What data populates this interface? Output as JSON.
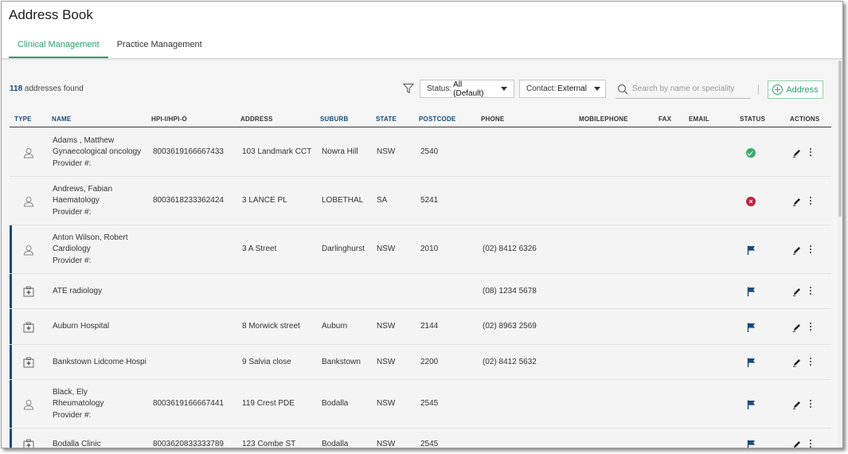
{
  "app": {
    "title": "Address Book"
  },
  "tabs": [
    {
      "label": "Clinical Management",
      "active": true
    },
    {
      "label": "Practice Management",
      "active": false
    }
  ],
  "toolbar": {
    "count": "118",
    "count_suffix": " addresses found",
    "status_label": "Status:",
    "status_value": "All (Default)",
    "contact_label": "Contact:",
    "contact_value": "External",
    "search_placeholder": "Search by name or speciality",
    "add_label": "Address"
  },
  "columns": {
    "type": "TYPE",
    "name": "NAME",
    "hpi": "HPI-I/HPI-O",
    "address": "ADDRESS",
    "suburb": "SUBURB",
    "state": "STATE",
    "postcode": "POSTCODE",
    "phone": "PHONE",
    "mobile": "MOBILEPHONE",
    "fax": "FAX",
    "email": "EMAIL",
    "status": "STATUS",
    "actions": "ACTIONS"
  },
  "colors": {
    "accent": "#2e9e6b",
    "navy": "#1a4a78",
    "ok": "#3aaa6b",
    "error": "#c0213f"
  },
  "rows": [
    {
      "type_icon": "person-icon",
      "name": [
        "Adams , Matthew",
        "Gynaecological oncology",
        "Provider #:"
      ],
      "hpi": "8003619166667433",
      "address": "103 Landmark CCT",
      "suburb": "Nowra Hill",
      "state": "NSW",
      "postcode": "2540",
      "phone": "",
      "status": "active",
      "marker": false
    },
    {
      "type_icon": "person-icon",
      "name": [
        "Andrews, Fabian",
        "Haematology",
        "Provider #:"
      ],
      "hpi": "8003618233362424",
      "address": "3 LANCE PL",
      "suburb": "LOBETHAL",
      "state": "SA",
      "postcode": "5241",
      "phone": "",
      "status": "inactive",
      "marker": false
    },
    {
      "type_icon": "person-icon",
      "name": [
        "Anton Wilson, Robert",
        "Cardiology",
        "Provider #:"
      ],
      "hpi": "",
      "address": "3 A Street",
      "suburb": "Darlinghurst",
      "state": "NSW",
      "postcode": "2010",
      "phone": "(02) 8412 6326",
      "status": "flagged",
      "marker": true
    },
    {
      "type_icon": "hospital-icon",
      "name": [
        "ATE radiology"
      ],
      "hpi": "",
      "address": "",
      "suburb": "",
      "state": "",
      "postcode": "",
      "phone": "(08) 1234 5678",
      "status": "flagged",
      "marker": true
    },
    {
      "type_icon": "hospital-icon",
      "name": [
        "Auburn Hospital"
      ],
      "hpi": "",
      "address": "8 Morwick street",
      "suburb": "Auburn",
      "state": "NSW",
      "postcode": "2144",
      "phone": "(02) 8963 2569",
      "status": "flagged",
      "marker": true
    },
    {
      "type_icon": "hospital-icon",
      "name": [
        "Bankstown Lidcome Hospi"
      ],
      "hpi": "",
      "address": "9 Salvia close",
      "suburb": "Bankstown",
      "state": "NSW",
      "postcode": "2200",
      "phone": "(02) 8412 5632",
      "status": "flagged",
      "marker": true
    },
    {
      "type_icon": "person-icon",
      "name": [
        "Black, Ely",
        "Rheumatology",
        "Provider #:"
      ],
      "hpi": "8003619166667441",
      "address": "119 Crest PDE",
      "suburb": "Bodalla",
      "state": "NSW",
      "postcode": "2545",
      "phone": "",
      "status": "flagged",
      "marker": true
    },
    {
      "type_icon": "hospital-icon",
      "name": [
        "Bodalla Clinic"
      ],
      "hpi": "8003620833333789",
      "address": "123 Combe ST",
      "suburb": "Bodalla",
      "state": "NSW",
      "postcode": "2545",
      "phone": "",
      "status": "flagged",
      "marker": true
    }
  ]
}
